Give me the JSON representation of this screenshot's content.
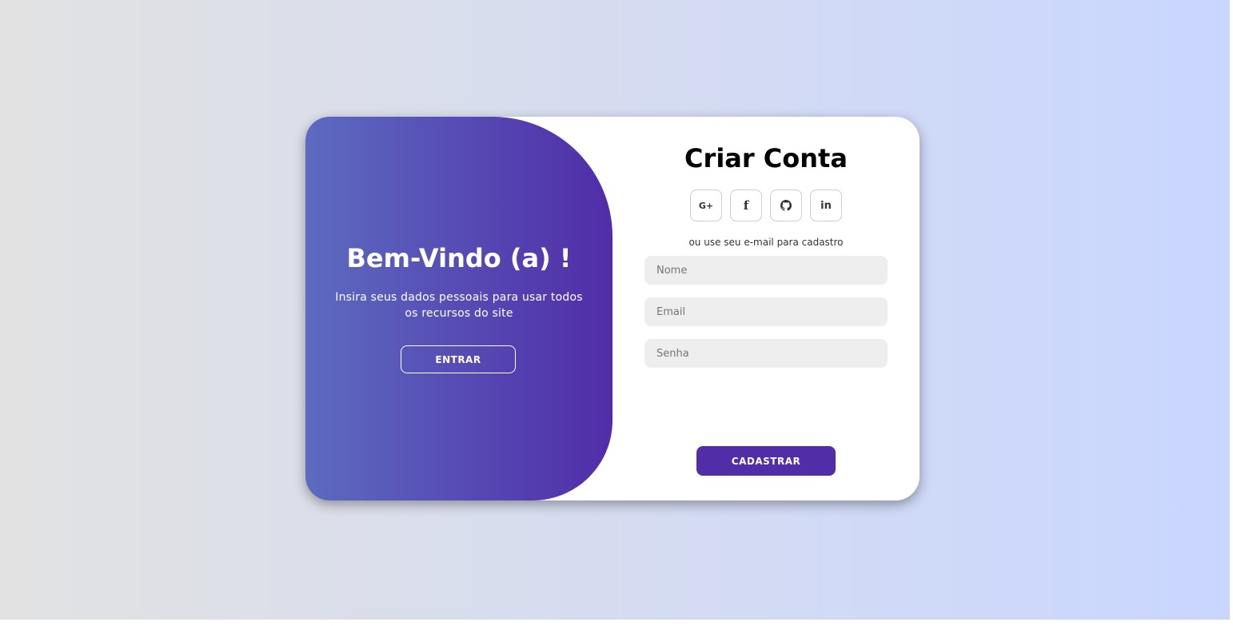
{
  "colors": {
    "background_start": "#e2e2e2",
    "background_end": "#c9d6ff",
    "panel_start": "#5c6bc0",
    "panel_end": "#512da8",
    "accent": "#512da8",
    "field_bg": "#eeeeee"
  },
  "toggle": {
    "title": "Bem-Vindo (a) !",
    "description": "Insira seus dados pessoais para usar todos os recursos do site",
    "button_label": "ENTRAR"
  },
  "signup": {
    "title": "Criar Conta",
    "social": [
      {
        "icon": "google-plus-icon",
        "glyph": "G+"
      },
      {
        "icon": "facebook-icon",
        "glyph": "f"
      },
      {
        "icon": "github-icon",
        "glyph": ""
      },
      {
        "icon": "linkedin-icon",
        "glyph": "in"
      }
    ],
    "hint": "ou use seu e-mail para cadastro",
    "fields": {
      "name_placeholder": "Nome",
      "email_placeholder": "Email",
      "password_placeholder": "Senha"
    },
    "button_label": "CADASTRAR"
  }
}
